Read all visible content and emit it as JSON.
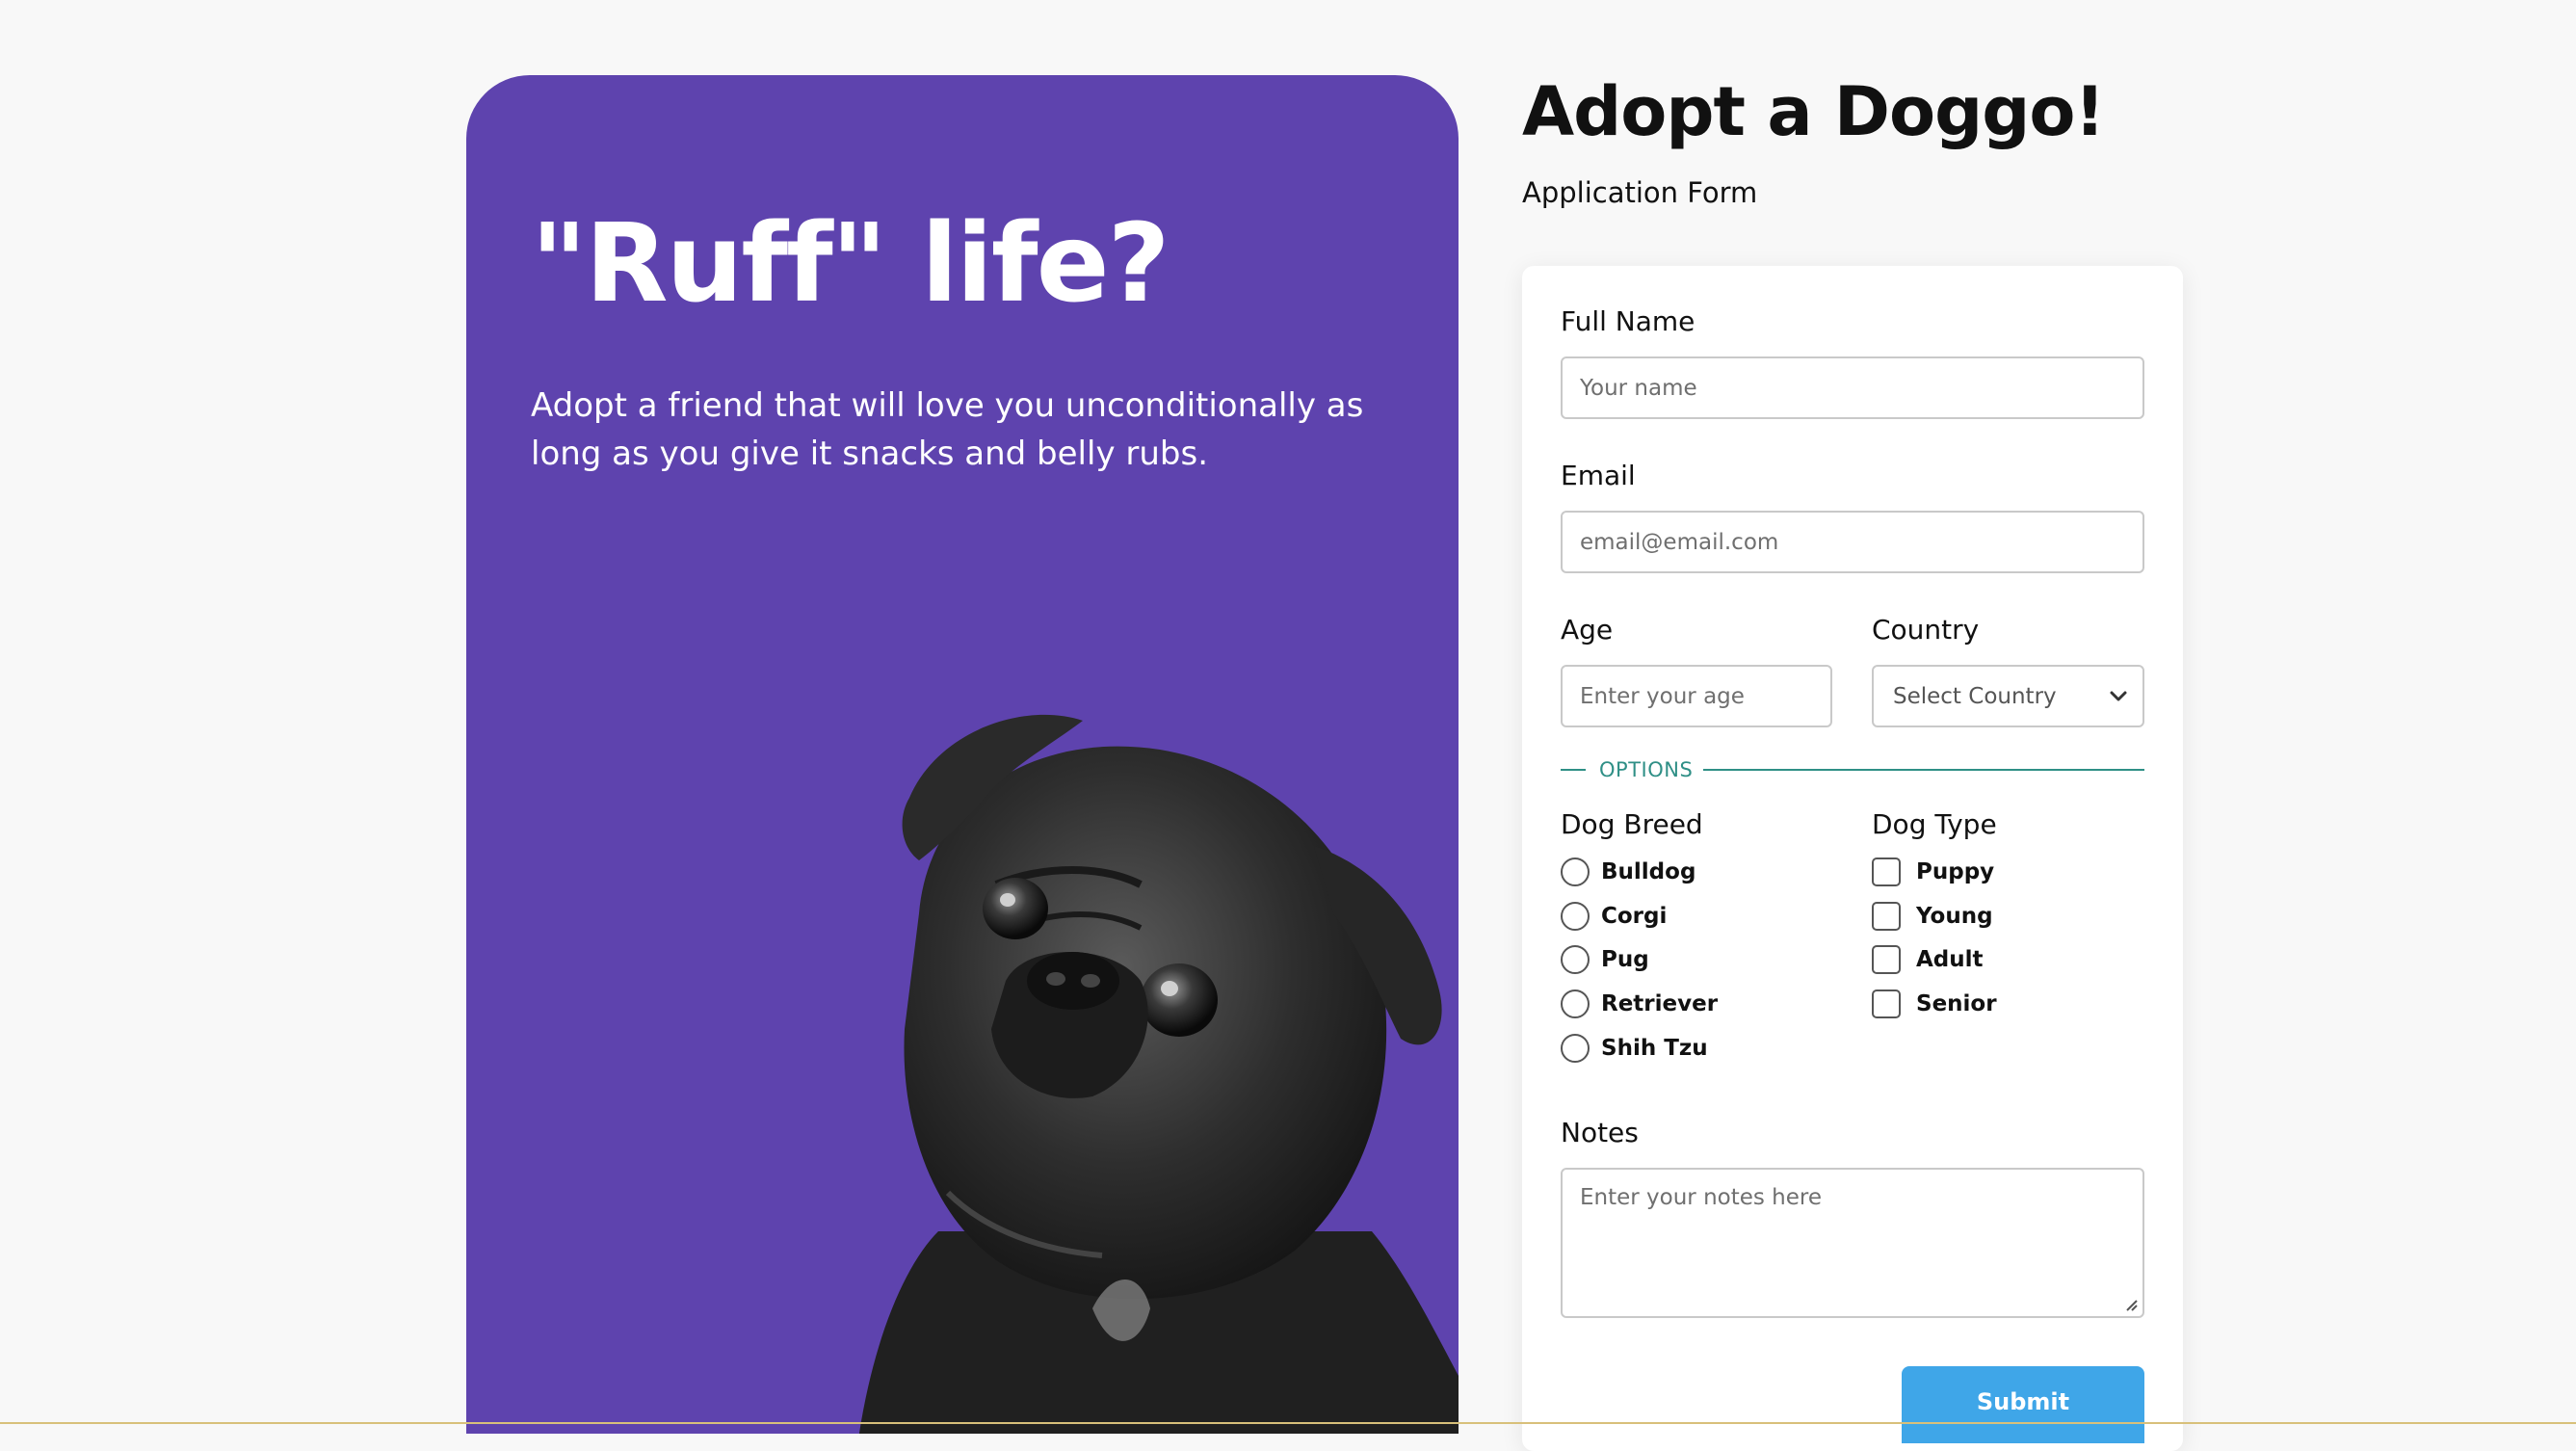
{
  "hero": {
    "title": "\"Ruff\" life?",
    "text": "Adopt a friend that will love you unconditionally as long as you give it snacks and belly rubs."
  },
  "page": {
    "title": "Adopt a Doggo!",
    "subtitle": "Application Form"
  },
  "form": {
    "full_name": {
      "label": "Full Name",
      "placeholder": "Your name",
      "value": ""
    },
    "email": {
      "label": "Email",
      "placeholder": "email@email.com",
      "value": ""
    },
    "age": {
      "label": "Age",
      "placeholder": "Enter your age",
      "value": ""
    },
    "country": {
      "label": "Country",
      "selected": "Select Country"
    },
    "options_label": "OPTIONS",
    "dog_breed": {
      "label": "Dog Breed",
      "options": [
        "Bulldog",
        "Corgi",
        "Pug",
        "Retriever",
        "Shih Tzu"
      ]
    },
    "dog_type": {
      "label": "Dog Type",
      "options": [
        "Puppy",
        "Young",
        "Adult",
        "Senior"
      ]
    },
    "notes": {
      "label": "Notes",
      "placeholder": "Enter your notes here",
      "value": ""
    },
    "submit_label": "Submit"
  },
  "colors": {
    "hero_bg": "#5e43ae",
    "accent_teal": "#2f8f86",
    "submit_bg": "#3fa6e8",
    "page_bg": "#f8f8f8"
  },
  "icons": {
    "select_chevron": "chevron-down-icon",
    "textarea_resize": "resize-grip-icon"
  }
}
